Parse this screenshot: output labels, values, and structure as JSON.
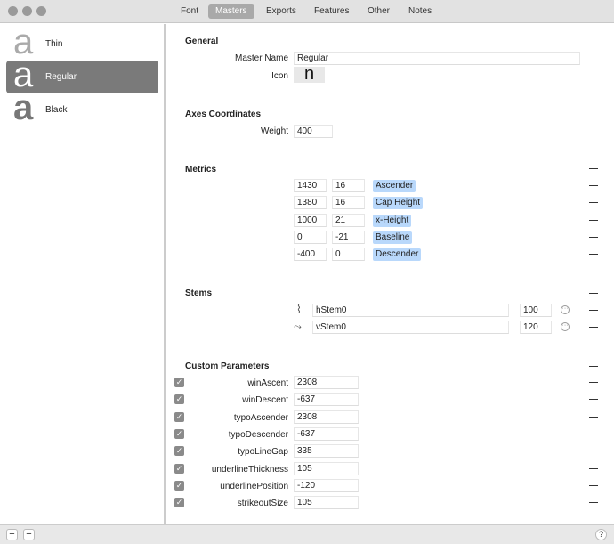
{
  "tabs": [
    "Font",
    "Masters",
    "Exports",
    "Features",
    "Other",
    "Notes"
  ],
  "selected_tab": "Masters",
  "masters": [
    {
      "glyph": "a",
      "name": "Thin"
    },
    {
      "glyph": "a",
      "name": "Regular"
    },
    {
      "glyph": "a",
      "name": "Black"
    }
  ],
  "general": {
    "title": "General",
    "master_name_label": "Master Name",
    "master_name": "Regular",
    "icon_label": "Icon",
    "icon_glyph": "n"
  },
  "axes": {
    "title": "Axes Coordinates",
    "weight_label": "Weight",
    "weight": "400"
  },
  "metrics": {
    "title": "Metrics",
    "rows": [
      {
        "value": "1430",
        "overshoot": "16",
        "name": "Ascender"
      },
      {
        "value": "1380",
        "overshoot": "16",
        "name": "Cap Height"
      },
      {
        "value": "1000",
        "overshoot": "21",
        "name": "x-Height"
      },
      {
        "value": "0",
        "overshoot": "-21",
        "name": "Baseline"
      },
      {
        "value": "-400",
        "overshoot": "0",
        "name": "Descender"
      }
    ]
  },
  "stems": {
    "title": "Stems",
    "rows": [
      {
        "name": "hStem0",
        "value": "100"
      },
      {
        "name": "vStem0",
        "value": "120"
      }
    ]
  },
  "custom": {
    "title": "Custom Parameters",
    "rows": [
      {
        "name": "winAscent",
        "value": "2308"
      },
      {
        "name": "winDescent",
        "value": "-637"
      },
      {
        "name": "typoAscender",
        "value": "2308"
      },
      {
        "name": "typoDescender",
        "value": "-637"
      },
      {
        "name": "typoLineGap",
        "value": "335"
      },
      {
        "name": "underlineThickness",
        "value": "105"
      },
      {
        "name": "underlinePosition",
        "value": "-120"
      },
      {
        "name": "strikeoutSize",
        "value": "105"
      }
    ]
  },
  "bottom": {
    "add": "+",
    "remove": "−",
    "help": "?"
  }
}
